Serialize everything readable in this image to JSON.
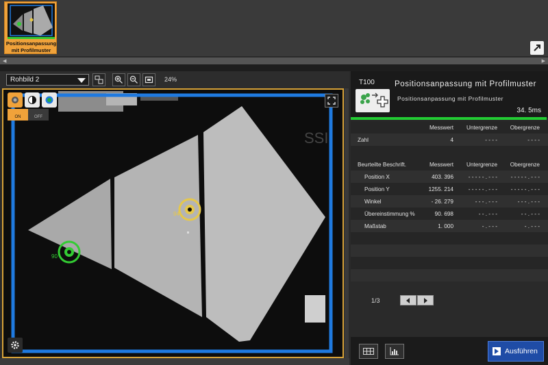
{
  "thumbnail": {
    "label_line1": "Positionsanpassung",
    "label_line2": "mit Profilmuster",
    "status_color": "#33cc33"
  },
  "toolbar": {
    "image_select": "Rohbild 2",
    "zoom": "24%"
  },
  "image_view": {
    "on_label": "ON",
    "off_label": "OFF",
    "frame_color": "#d8a338",
    "roi_color": "#1f7ae0",
    "marker1_angle": "90",
    "marker2_angle": "94",
    "marker1_color": "#33cc33",
    "marker2_color": "#e6c84a",
    "bg_text": "SSI"
  },
  "results": {
    "tool_id": "T100",
    "tool_name": "Positionsanpassung  mit  Profilmuster",
    "tool_subtitle": "Positionsanpassung  mit  Profilmuster",
    "exec_time": "34. 5ms",
    "table1": {
      "headers": [
        "",
        "Messwert",
        "Untergrenze",
        "Obergrenze"
      ],
      "rows": [
        [
          "Zahl",
          "4",
          "- - - -",
          "- - - -"
        ]
      ]
    },
    "table2": {
      "headers": [
        "Beurteilte  Beschrift.",
        "Messwert",
        "Untergrenze",
        "Obergrenze"
      ],
      "rows": [
        [
          "Position  X",
          "403. 396",
          "- - - - - . - - -",
          "- - - - - . - - -"
        ],
        [
          "Position  Y",
          "1255. 214",
          "- - - - - . - - -",
          "- - - - - . - - -"
        ],
        [
          "Winkel",
          "- 26. 279",
          "- - - . - - -",
          "- - - . - - -"
        ],
        [
          "Übereinstimmung  %",
          "90. 698",
          "- - . - - -",
          "- - . - - -"
        ],
        [
          "Maßstab",
          "1. 000",
          "- . - - -",
          "- . - - -"
        ]
      ]
    },
    "page": "1/3",
    "run_label": "Ausführen"
  },
  "icons": [
    "image-layout-icon",
    "zoom-in-icon",
    "zoom-out-icon",
    "fit-screen-icon",
    "fullscreen-icon",
    "gear-icon",
    "expand-icon",
    "play-icon",
    "grid-icon",
    "bar-chart-icon"
  ]
}
